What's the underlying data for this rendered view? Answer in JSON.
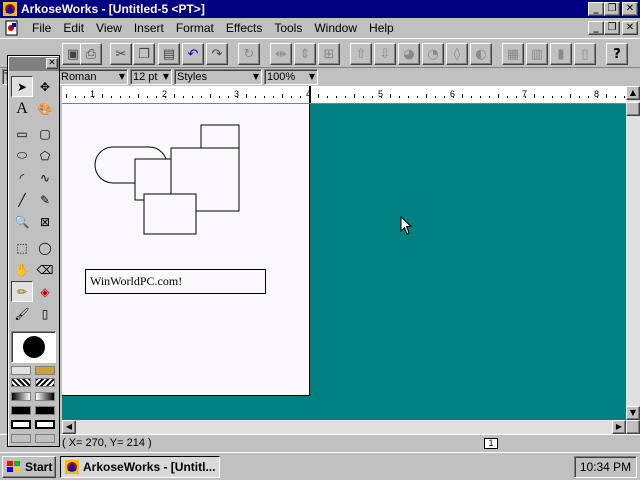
{
  "window": {
    "title": "ArkoseWorks - [Untitled-5 <PT>]",
    "controls": {
      "minimize": "_",
      "maximize": "❐",
      "close": "✕"
    }
  },
  "menubar": {
    "items": [
      "File",
      "Edit",
      "View",
      "Insert",
      "Format",
      "Effects",
      "Tools",
      "Window",
      "Help"
    ]
  },
  "formatbar": {
    "font": "Roman",
    "font_partial": "T",
    "size": "12 pt",
    "style": "Styles",
    "zoom": "100%"
  },
  "ruler": {
    "labels": [
      "1",
      "2",
      "3",
      "4",
      "5",
      "6",
      "7",
      "8"
    ]
  },
  "canvas": {
    "textbox_text": "WinWorldPC.com!"
  },
  "statusbar": {
    "coordinates": "( X= 270, Y= 214 )",
    "page_number": "1"
  },
  "taskbar": {
    "start_label": "Start",
    "task_label": "ArkoseWorks - [Untitl...",
    "clock": "10:34 PM"
  },
  "toolbar": {
    "icons": [
      "new-icon",
      "open-icon",
      "save-icon",
      "print-icon",
      "cut-icon",
      "copy-icon",
      "paste-icon",
      "undo-icon",
      "redo-icon",
      "rotate-icon",
      "flip-horizontal-icon",
      "flip-vertical-icon",
      "bring-forward-icon",
      "send-backward-icon",
      "bring-front-icon",
      "send-back-icon",
      "transparency-icon",
      "lighting-icon",
      "pattern-icon",
      "gradient-icon",
      "shadow-icon",
      "outline-icon",
      "help-icon"
    ]
  },
  "palette": {
    "fill_color": "#000000",
    "tools": [
      "pointer-tool",
      "move-tool",
      "text-tool",
      "palette-tool",
      "rectangle-tool",
      "rounded-rectangle-tool",
      "ellipse-tool",
      "polygon-tool",
      "arc-tool",
      "freeform-tool",
      "line-tool",
      "eyedropper-tool",
      "zoom-tool",
      "crop-tool",
      "marquee-select-tool",
      "lasso-tool",
      "hand-tool",
      "eraser-tool",
      "pencil-tool",
      "paint-bucket-tool",
      "brush-tool",
      "spray-tool"
    ]
  }
}
